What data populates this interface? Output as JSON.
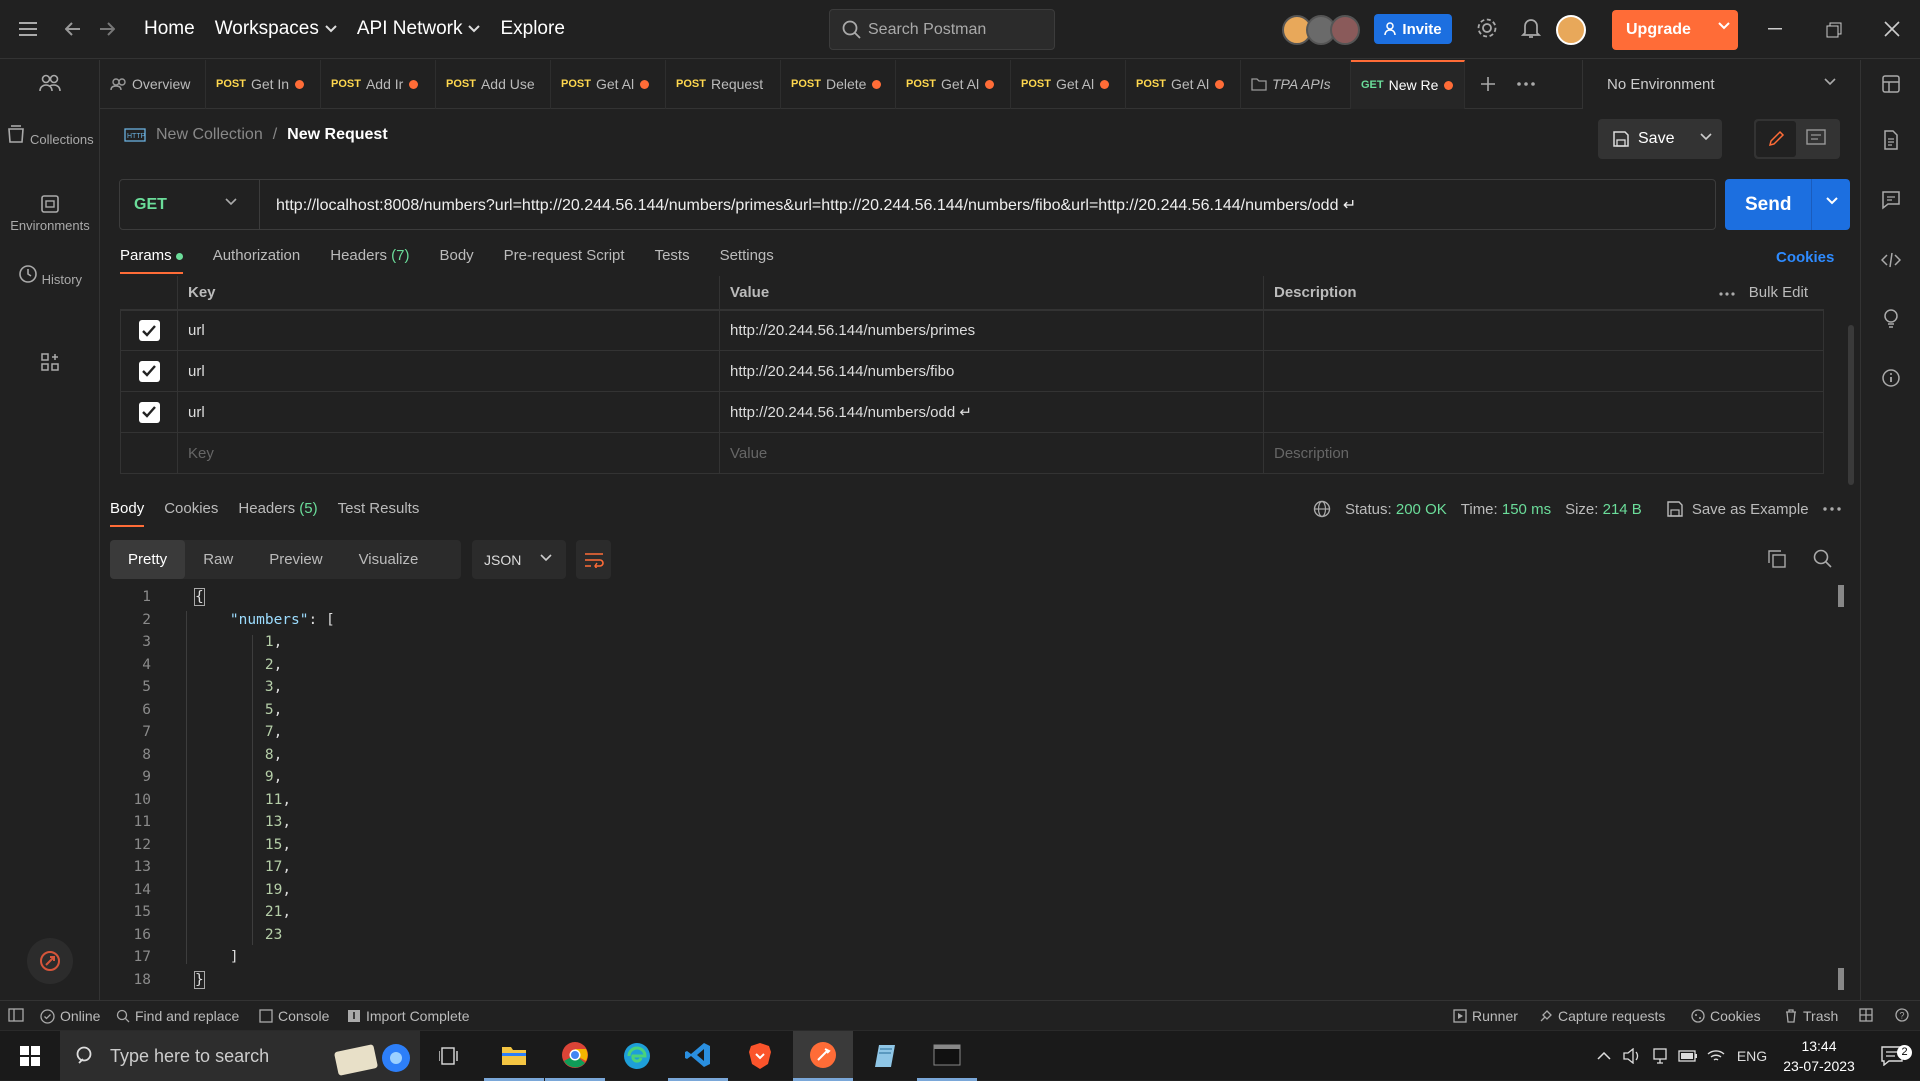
{
  "topbar": {
    "nav": [
      "Home",
      "Workspaces",
      "API Network",
      "Explore"
    ],
    "search_placeholder": "Search Postman",
    "invite": "Invite",
    "upgrade": "Upgrade"
  },
  "rail": [
    {
      "label": "",
      "icon": "team-icon"
    },
    {
      "label": "Collections",
      "icon": "collections-icon"
    },
    {
      "label": "Environments",
      "icon": "environments-icon"
    },
    {
      "label": "History",
      "icon": "history-icon"
    },
    {
      "label": "",
      "icon": "apps-grid-icon"
    }
  ],
  "tabs": [
    {
      "method": "",
      "label": "Overview",
      "dot": false
    },
    {
      "method": "POST",
      "label": "Get In",
      "dot": true
    },
    {
      "method": "POST",
      "label": "Add Ir",
      "dot": true
    },
    {
      "method": "POST",
      "label": "Add Use",
      "dot": false
    },
    {
      "method": "POST",
      "label": "Get Al",
      "dot": true
    },
    {
      "method": "POST",
      "label": "Request",
      "dot": false
    },
    {
      "method": "POST",
      "label": "Delete",
      "dot": true
    },
    {
      "method": "POST",
      "label": "Get Al",
      "dot": true
    },
    {
      "method": "POST",
      "label": "Get Al",
      "dot": true
    },
    {
      "method": "POST",
      "label": "Get Al",
      "dot": true
    },
    {
      "method": "",
      "label": "TPA APIs",
      "dot": false
    },
    {
      "method": "GET",
      "label": "New Re",
      "dot": true
    }
  ],
  "environment": "No Environment",
  "breadcrumb": {
    "collection": "New Collection",
    "separator": "/",
    "request": "New Request"
  },
  "save_label": "Save",
  "request": {
    "method": "GET",
    "url": "http://localhost:8008/numbers?url=http://20.244.56.144/numbers/primes&url=http://20.244.56.144/numbers/fibo&url=http://20.244.56.144/numbers/odd ↵",
    "send": "Send"
  },
  "request_tabs": {
    "params": "Params",
    "authorization": "Authorization",
    "headers": "Headers",
    "headers_count": "(7)",
    "body": "Body",
    "prerequest": "Pre-request Script",
    "tests": "Tests",
    "settings": "Settings",
    "cookies": "Cookies"
  },
  "params": {
    "headers": {
      "key": "Key",
      "value": "Value",
      "description": "Description",
      "bulk_edit": "Bulk Edit"
    },
    "rows": [
      {
        "key": "url",
        "value": "http://20.244.56.144/numbers/primes"
      },
      {
        "key": "url",
        "value": "http://20.244.56.144/numbers/fibo"
      },
      {
        "key": "url",
        "value": "http://20.244.56.144/numbers/odd ↵"
      }
    ],
    "placeholders": {
      "key": "Key",
      "value": "Value",
      "description": "Description"
    }
  },
  "response": {
    "tabs": {
      "body": "Body",
      "cookies": "Cookies",
      "headers": "Headers",
      "headers_count": "(5)",
      "tests": "Test Results"
    },
    "status_label": "Status:",
    "status": "200 OK",
    "time_label": "Time:",
    "time": "150 ms",
    "size_label": "Size:",
    "size": "214 B",
    "save_example": "Save as Example",
    "view_modes": [
      "Pretty",
      "Raw",
      "Preview",
      "Visualize"
    ],
    "format": "JSON",
    "json_key": "\"numbers\"",
    "numbers": [
      1,
      2,
      3,
      5,
      7,
      8,
      9,
      11,
      13,
      15,
      17,
      19,
      21,
      23
    ]
  },
  "statusbar": {
    "online": "Online",
    "find": "Find and replace",
    "console": "Console",
    "import": "Import Complete",
    "runner": "Runner",
    "capture": "Capture requests",
    "cookies": "Cookies",
    "trash": "Trash"
  },
  "taskbar": {
    "search_placeholder": "Type here to search",
    "lang": "ENG",
    "time": "13:44",
    "date": "23-07-2023",
    "notifications": "2"
  },
  "colors": {
    "accent": "#ff6c37",
    "primary": "#1c6fe0",
    "success": "#6bdd9a",
    "post": "#ffd84f"
  }
}
